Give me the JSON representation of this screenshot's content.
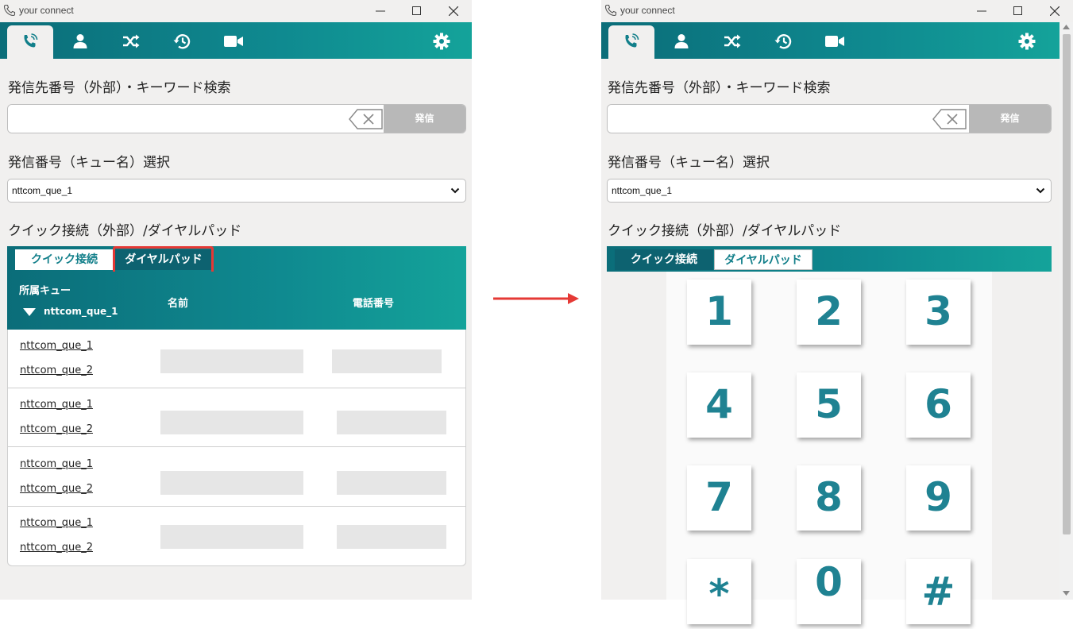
{
  "app": {
    "title": "your connect"
  },
  "left": {
    "search": {
      "label": "発信先番号（外部）・キーワード検索",
      "value": "",
      "placeholder": "",
      "dial_label": "発信"
    },
    "queue_select": {
      "label": "発信番号（キュー名）選択",
      "value": "nttcom_que_1"
    },
    "quick": {
      "label": "クイック接続（外部）/ダイヤルパッド",
      "tabs": [
        "クイック接続",
        "ダイヤルパッド"
      ],
      "active_tab": "クイック接続",
      "highlighted_tab": "ダイヤルパッド"
    },
    "table": {
      "header_queue": "所属キュー",
      "header_queue_filter": "nttcom_que_1",
      "header_name": "名前",
      "header_phone": "電話番号",
      "rows": [
        {
          "queues": [
            "nttcom_que_1",
            "nttcom_que_2"
          ]
        },
        {
          "queues": [
            "nttcom_que_1",
            "nttcom_que_2"
          ]
        },
        {
          "queues": [
            "nttcom_que_1",
            "nttcom_que_2"
          ]
        },
        {
          "queues": [
            "nttcom_que_1",
            "nttcom_que_2"
          ]
        }
      ]
    }
  },
  "right": {
    "search": {
      "label": "発信先番号（外部）・キーワード検索",
      "value": "",
      "placeholder": "",
      "dial_label": "発信"
    },
    "queue_select": {
      "label": "発信番号（キュー名）選択",
      "value": "nttcom_que_1"
    },
    "quick": {
      "label": "クイック接続（外部）/ダイヤルパッド",
      "tabs": [
        "クイック接続",
        "ダイヤルパッド"
      ],
      "active_tab": "ダイヤルパッド"
    },
    "dialpad_keys": [
      "1",
      "2",
      "3",
      "4",
      "5",
      "6",
      "7",
      "8",
      "9",
      "*",
      "0",
      "#"
    ]
  },
  "colors": {
    "accent": "#0f8a90",
    "dialpad_digit": "#1f8292",
    "highlight": "#e53935",
    "arrow": "#e53935"
  },
  "nav_icons": [
    "phone-icon",
    "contact-icon",
    "transfer-icon",
    "history-icon",
    "video-icon",
    "settings-icon"
  ]
}
